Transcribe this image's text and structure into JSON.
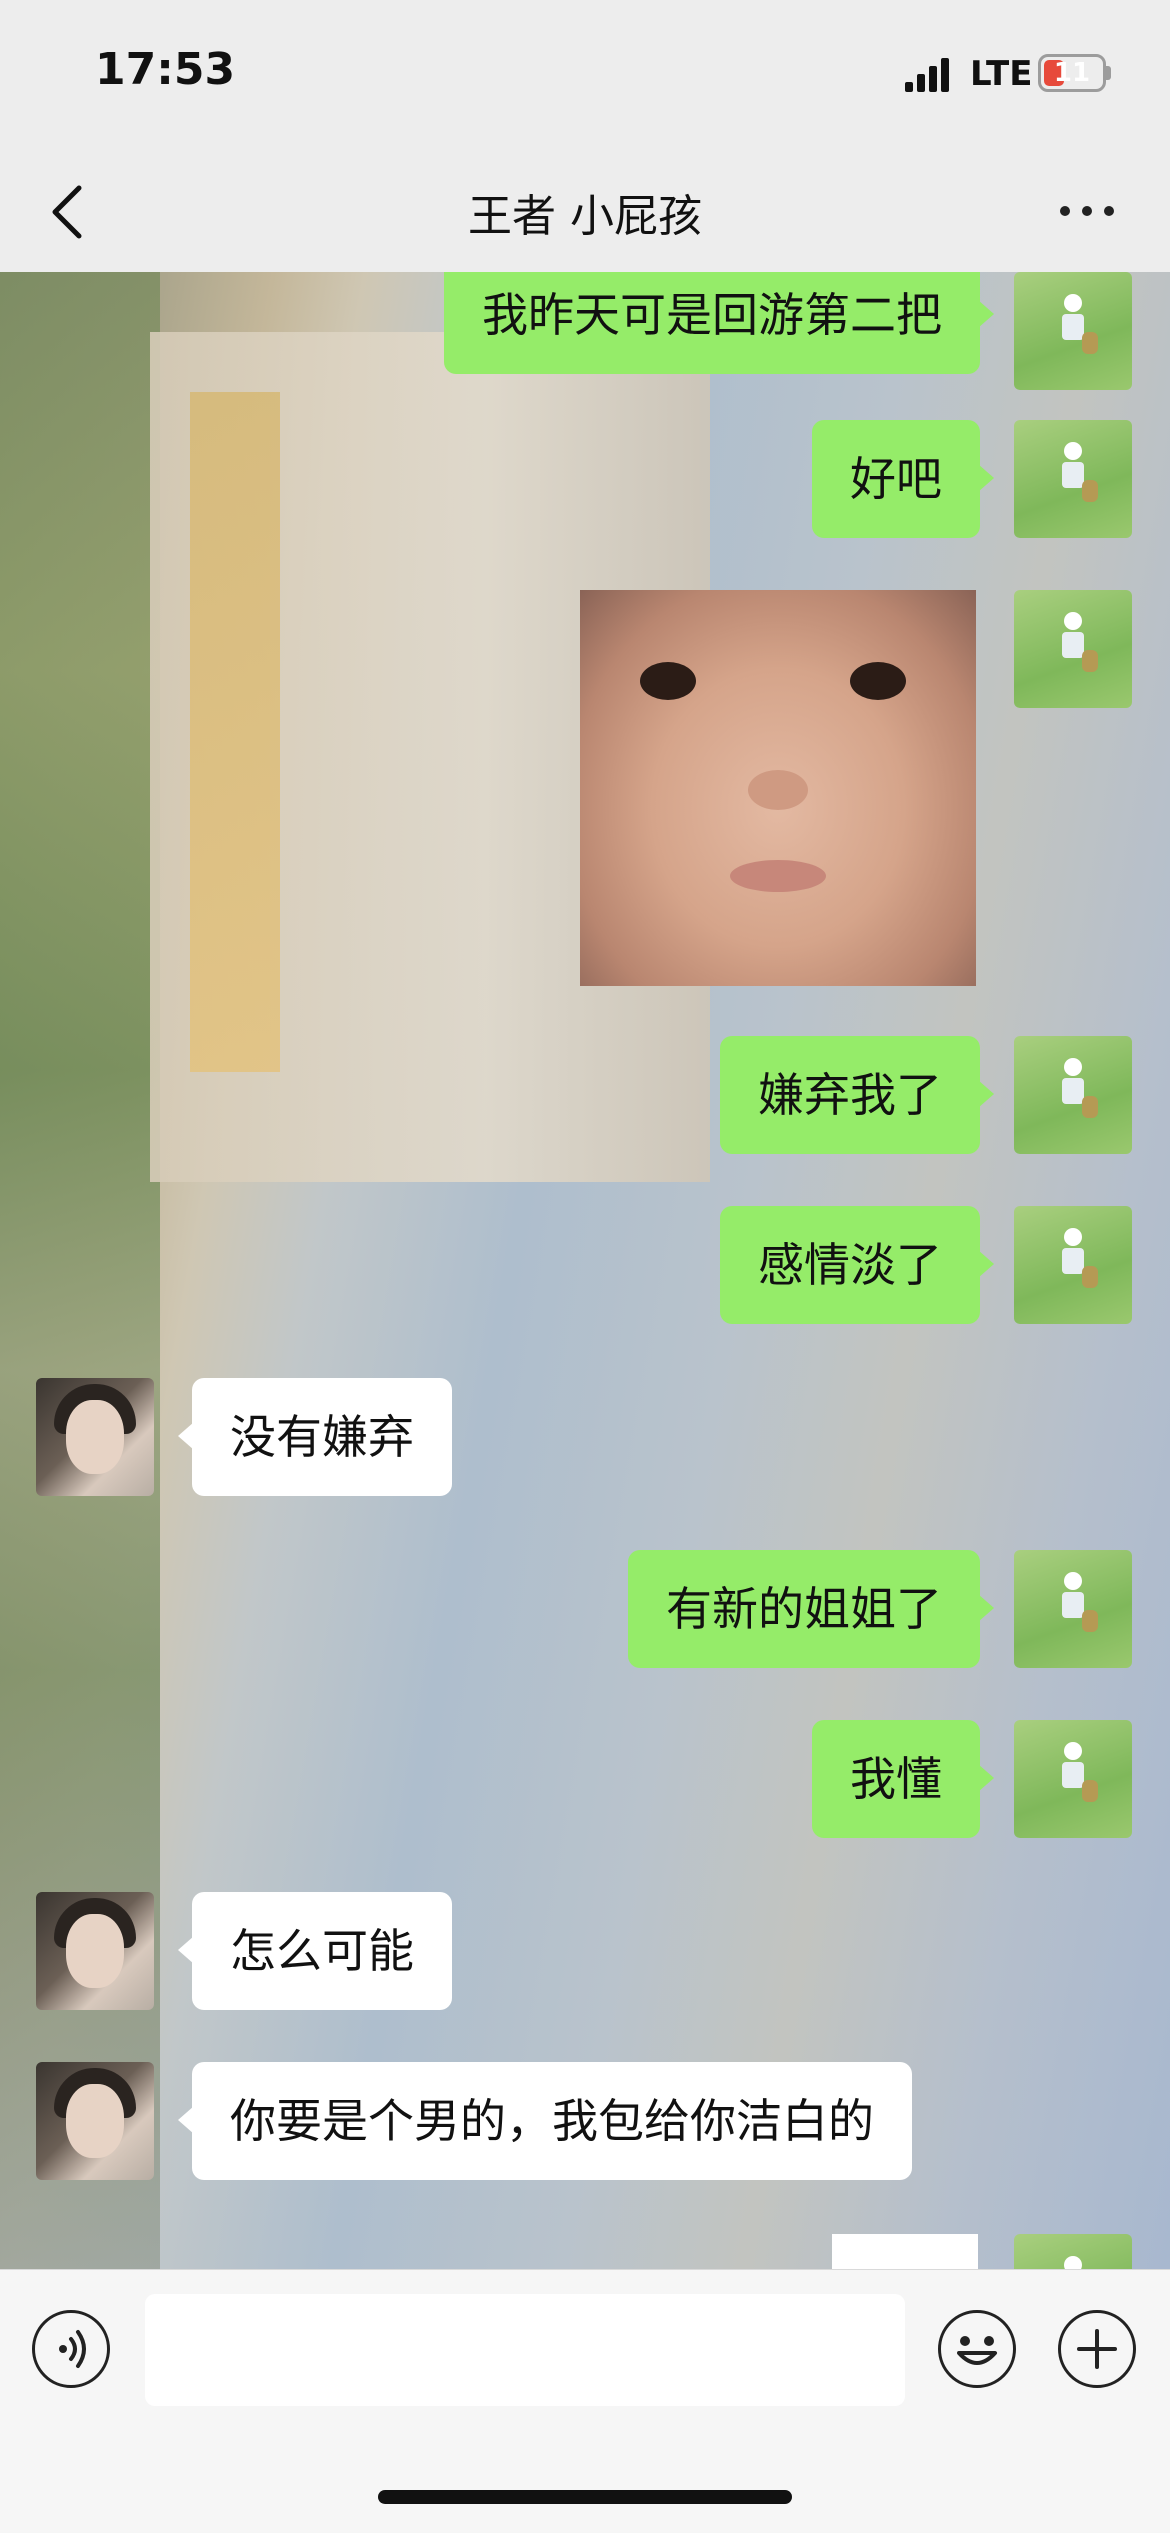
{
  "status": {
    "time": "17:53",
    "network": "LTE",
    "battery": "11"
  },
  "header": {
    "title": "王者  小屁孩"
  },
  "messages": {
    "m1": "我昨天可是回游第二把",
    "m2": "好吧",
    "m4": "嫌弃我了",
    "m5": "感情淡了",
    "m6": "没有嫌弃",
    "m7": "有新的姐姐了",
    "m8": "我懂",
    "m9": "怎么可能",
    "m10": "你要是个男的，我包给你洁白的"
  },
  "input": {
    "value": ""
  },
  "colors": {
    "my_bubble": "#95ec69",
    "their_bubble": "#ffffff",
    "background": "#ededed"
  },
  "icons": [
    "back-icon",
    "more-icon",
    "voice-icon",
    "emoji-icon",
    "plus-icon"
  ]
}
